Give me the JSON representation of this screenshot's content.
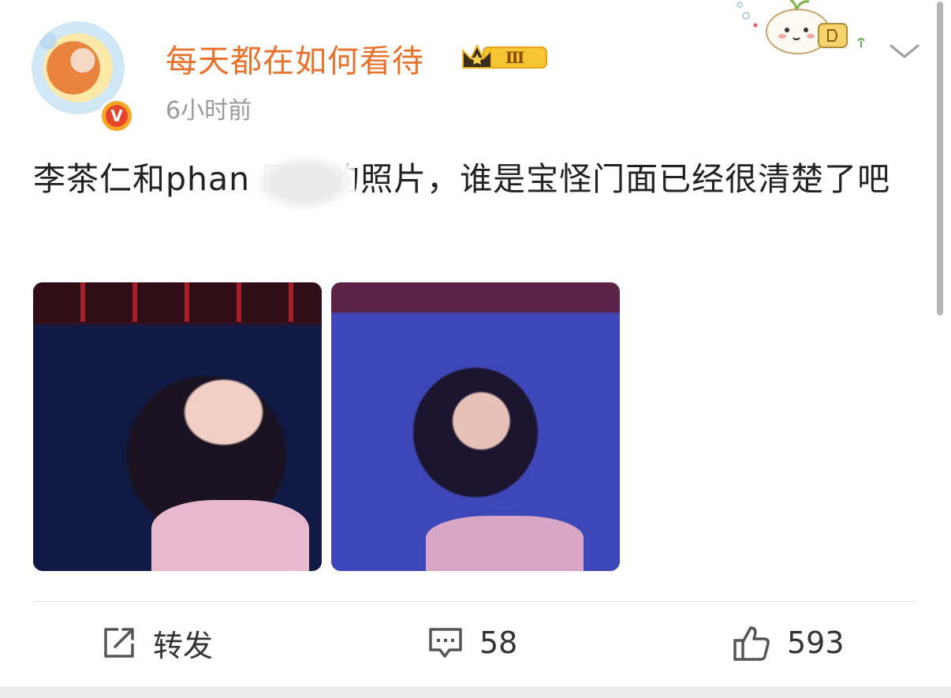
{
  "post": {
    "author": "每天都在如何看待",
    "level_badge": "Ⅲ",
    "verified_mark": "V",
    "timestamp": "6小时前",
    "text": "李茶仁和phan 同样的照片，谁是宝怪门面已经很清楚了吧",
    "image_count": 2
  },
  "actions": {
    "repost_label": "转发",
    "comment_count": "58",
    "like_count": "593"
  },
  "icons": {
    "repost": "repost-icon",
    "comment": "comment-icon",
    "like": "thumbs-up-icon",
    "more": "chevron-down-icon"
  },
  "colors": {
    "username": "#e8722c",
    "timestamp": "#9a9a9a",
    "text": "#222222",
    "verified": "#f5a623"
  }
}
